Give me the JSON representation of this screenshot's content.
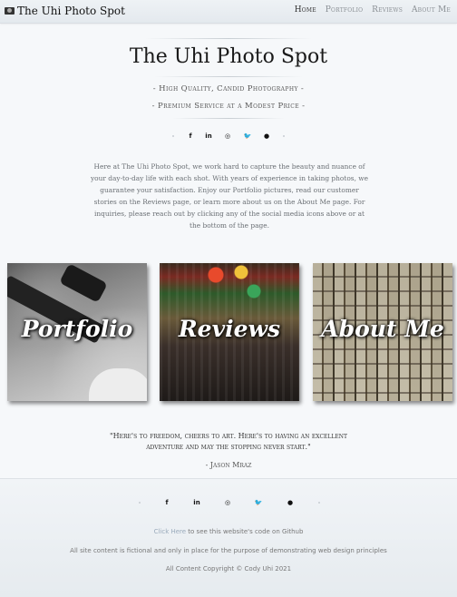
{
  "navbar": {
    "brand_icon": "camera-icon",
    "brand": "The Uhi Photo Spot",
    "links": [
      {
        "label": "Home",
        "active": true
      },
      {
        "label": "Portfolio",
        "active": false
      },
      {
        "label": "Reviews",
        "active": false
      },
      {
        "label": "About Me",
        "active": false
      }
    ]
  },
  "header": {
    "title": "The Uhi Photo Spot",
    "tagline_1": "- High Quality, Candid Photography -",
    "tagline_2": "- Premium Service at a Modest Price -"
  },
  "social_icons": [
    {
      "name": "facebook-icon",
      "glyph": "f"
    },
    {
      "name": "linkedin-icon",
      "glyph": "in"
    },
    {
      "name": "instagram-icon",
      "glyph": "◎"
    },
    {
      "name": "twitter-icon",
      "glyph": "🐦"
    },
    {
      "name": "github-icon",
      "glyph": "●"
    }
  ],
  "intro": "Here at The Uhi Photo Spot, we work hard to capture the beauty and nuance of your day-to-day life with each shot. With years of experience in taking photos, we guarantee your satisfaction. Enjoy our Portfolio pictures, read our customer stories on the Reviews page, or learn more about us on the About Me page. For inquiries, please reach out by clicking any of the social media icons above or at the bottom of the page.",
  "tiles": [
    {
      "label": "Portfolio"
    },
    {
      "label": "Reviews"
    },
    {
      "label": "About Me"
    }
  ],
  "quote": {
    "text": "\"Here's to freedom, cheers to art. Here's to having an excellent adventure and may the stopping never start.\"",
    "author": "- Jason Mraz"
  },
  "footer": {
    "link_text": "Click Here",
    "link_suffix": " to see this website's code on Github",
    "disclaimer": "All site content is fictional and only in place for the purpose of demonstrating web design principles",
    "copyright": "All Content Copyright © Cody Uhi 2021"
  }
}
